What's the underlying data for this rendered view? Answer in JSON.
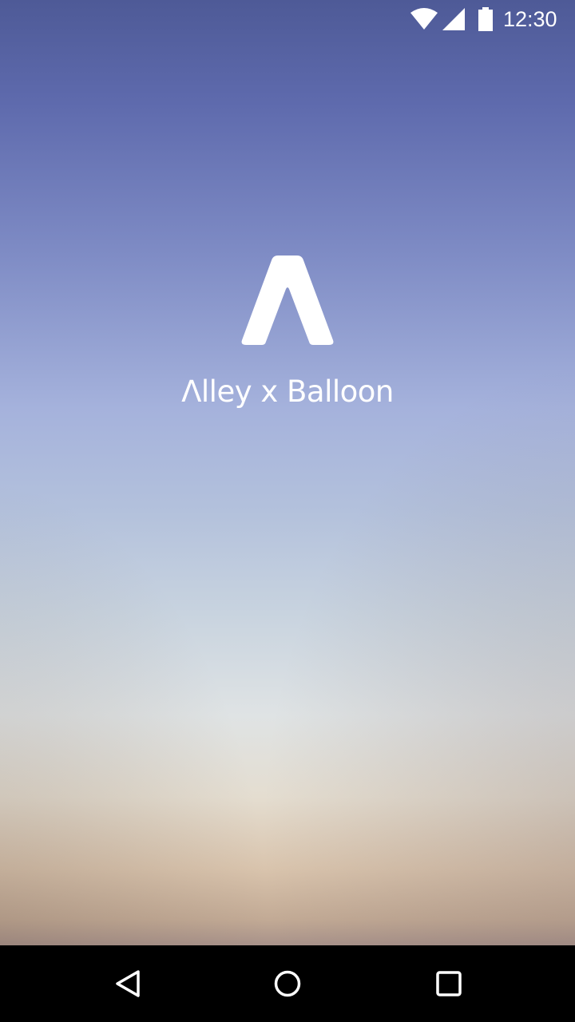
{
  "status_bar": {
    "time": "12:30",
    "icons": [
      "wifi-icon",
      "cell-signal-icon",
      "battery-icon"
    ]
  },
  "splash": {
    "logo_icon": "alley-logo-icon",
    "app_name": "Λlley x Balloon"
  },
  "navigation_bar": {
    "buttons": [
      "back-icon",
      "home-icon",
      "recents-icon"
    ]
  },
  "colors": {
    "gradient_top": "#4e5a97",
    "gradient_mid": "#a5b2dc",
    "gradient_light": "#dfe3e4",
    "gradient_bottom": "#c2aa95",
    "text": "#ffffff",
    "nav_bar": "#000000"
  }
}
